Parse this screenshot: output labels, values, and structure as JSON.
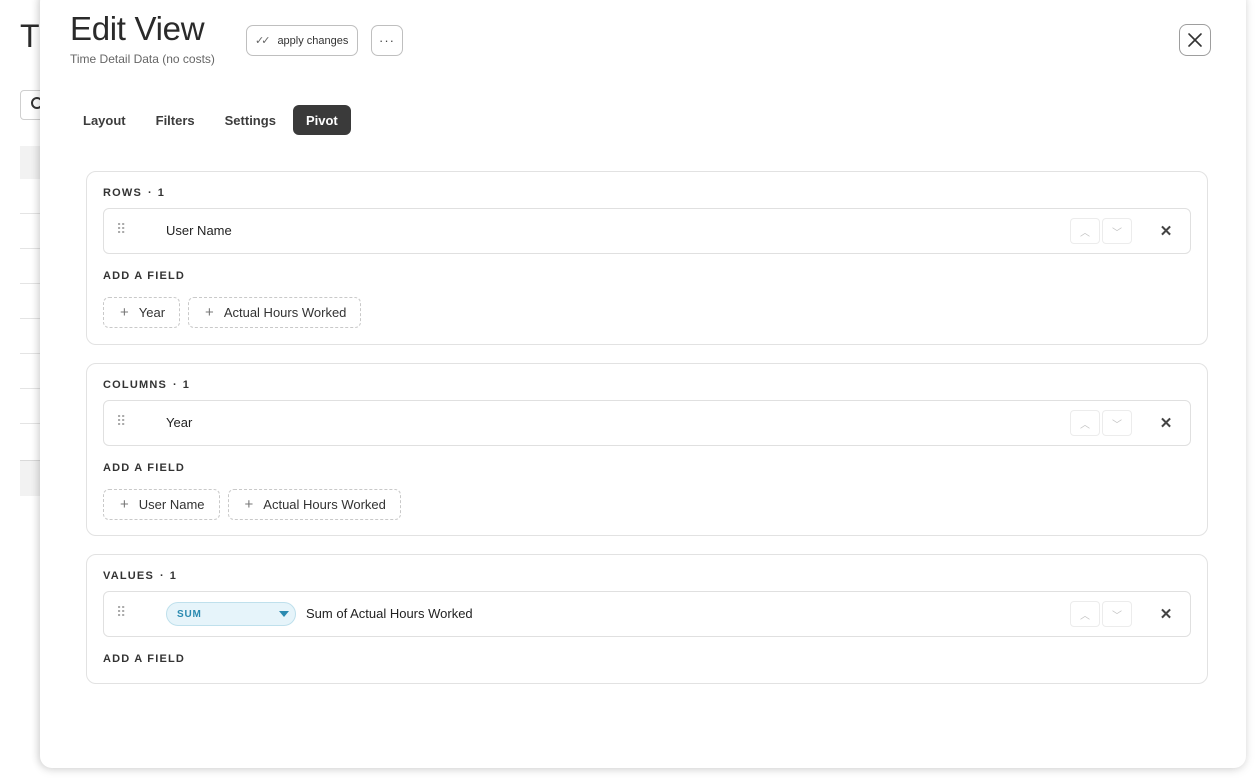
{
  "background": {
    "title_initial": "T"
  },
  "modal": {
    "title": "Edit View",
    "subtitle": "Time Detail Data (no costs)",
    "apply_label": "apply changes",
    "more_label": "···"
  },
  "tabs": [
    {
      "label": "Layout",
      "active": false
    },
    {
      "label": "Filters",
      "active": false
    },
    {
      "label": "Settings",
      "active": false
    },
    {
      "label": "Pivot",
      "active": true
    }
  ],
  "rows": {
    "label": "ROWS",
    "count": "1",
    "fields": [
      {
        "name": "User Name"
      }
    ],
    "add_label": "ADD A FIELD",
    "available": [
      "Year",
      "Actual Hours Worked"
    ]
  },
  "columns": {
    "label": "COLUMNS",
    "count": "1",
    "fields": [
      {
        "name": "Year"
      }
    ],
    "add_label": "ADD A FIELD",
    "available": [
      "User Name",
      "Actual Hours Worked"
    ]
  },
  "values": {
    "label": "VALUES",
    "count": "1",
    "fields": [
      {
        "aggregation": "SUM",
        "name": "Sum of Actual Hours Worked"
      }
    ],
    "add_label": "ADD A FIELD"
  },
  "colors": {
    "active_tab": "#3a3a3a",
    "agg_bg": "#e6f4fa",
    "agg_text": "#2a8ab0"
  }
}
